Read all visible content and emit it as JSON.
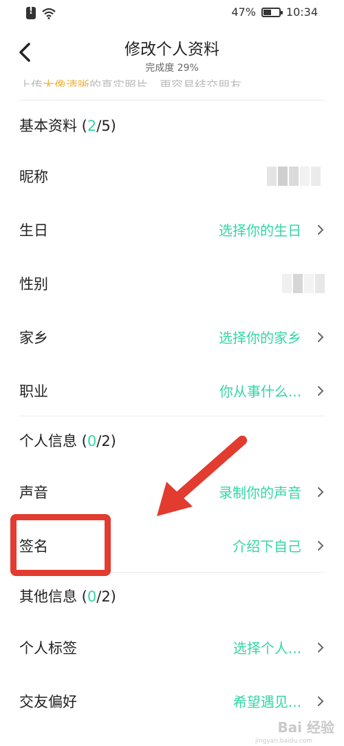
{
  "status_bar": {
    "battery_percent": "47%",
    "time": "10:34"
  },
  "header": {
    "title": "修改个人资料",
    "completion": "完成度 29%"
  },
  "hint": {
    "before": "上传",
    "highlight": "大像清晰",
    "after": "的真实照片，更容易结交朋友"
  },
  "basic_section": {
    "title": "基本资料",
    "open": " (",
    "count": "2",
    "total": "/5)"
  },
  "basic_rows": {
    "nickname": {
      "label": "昵称",
      "value": ""
    },
    "birthday": {
      "label": "生日",
      "value": "选择你的生日"
    },
    "gender": {
      "label": "性别",
      "value": ""
    },
    "hometown": {
      "label": "家乡",
      "value": "选择你的家乡"
    },
    "job": {
      "label": "职业",
      "value": "你从事什么..."
    }
  },
  "personal_section": {
    "title": "个人信息",
    "open": " (",
    "count": "0",
    "total": "/2)"
  },
  "personal_rows": {
    "voice": {
      "label": "声音",
      "value": "录制你的声音"
    },
    "signature": {
      "label": "签名",
      "value": "介绍下自己"
    }
  },
  "other_section": {
    "title": "其他信息",
    "open": " (",
    "count": "0",
    "total": "/2)"
  },
  "other_rows": {
    "tags": {
      "label": "个人标签",
      "value": "选择个人..."
    },
    "preference": {
      "label": "交友偏好",
      "value": "希望遇见..."
    }
  },
  "watermark": {
    "main": "Bai 经验",
    "sub": "jingyan.baidu.com"
  },
  "colors": {
    "accent": "#33d6a4",
    "annotation": "#e23b2f",
    "hint_highlight": "#f0b44a"
  }
}
